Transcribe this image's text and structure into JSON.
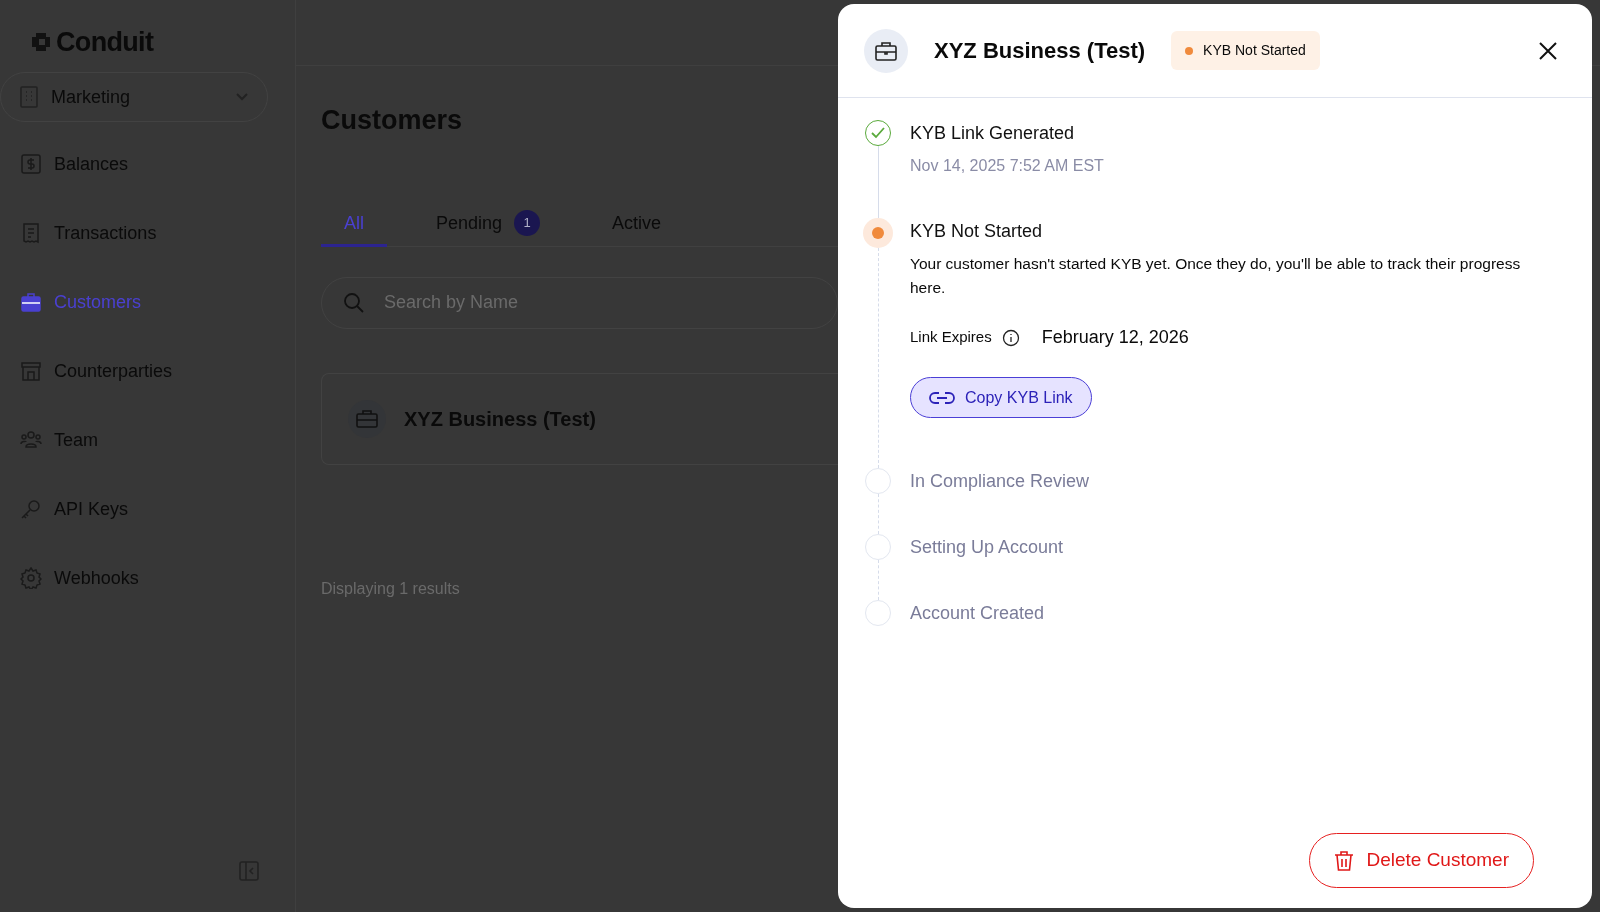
{
  "sidebar": {
    "logo": "Conduit",
    "workspace": "Marketing",
    "items": [
      {
        "label": "Balances",
        "selected": false
      },
      {
        "label": "Transactions",
        "selected": false
      },
      {
        "label": "Customers",
        "selected": true
      },
      {
        "label": "Counterparties",
        "selected": false
      },
      {
        "label": "Team",
        "selected": false
      },
      {
        "label": "API Keys",
        "selected": false
      },
      {
        "label": "Webhooks",
        "selected": false
      }
    ]
  },
  "page": {
    "title": "Customers",
    "tabs": [
      {
        "label": "All",
        "selected": true
      },
      {
        "label": "Pending",
        "selected": false,
        "count": "1"
      },
      {
        "label": "Active",
        "selected": false
      }
    ],
    "search": {
      "placeholder": "Search by Name"
    },
    "rows": [
      {
        "name": "XYZ Business (Test)"
      }
    ],
    "footer": "Displaying 1 results"
  },
  "panel": {
    "title": "XYZ Business (Test)",
    "badge": {
      "label": "KYB Not Started",
      "color": "#f08a3c"
    },
    "steps": [
      {
        "kind": "done",
        "title": "KYB Link Generated",
        "time": "Nov 14, 2025 7:52 AM EST"
      },
      {
        "kind": "current",
        "title": "KYB Not Started",
        "description": "Your customer hasn't started KYB yet. Once they do, you'll be able to track their progress here.",
        "expiry_label": "Link Expires",
        "expiry_value": "February 12, 2026",
        "action": "Copy KYB Link"
      },
      {
        "kind": "pending",
        "title": "In Compliance Review"
      },
      {
        "kind": "pending",
        "title": "Setting Up Account"
      },
      {
        "kind": "pending",
        "title": "Account Created"
      }
    ],
    "delete_button": "Delete Customer"
  }
}
